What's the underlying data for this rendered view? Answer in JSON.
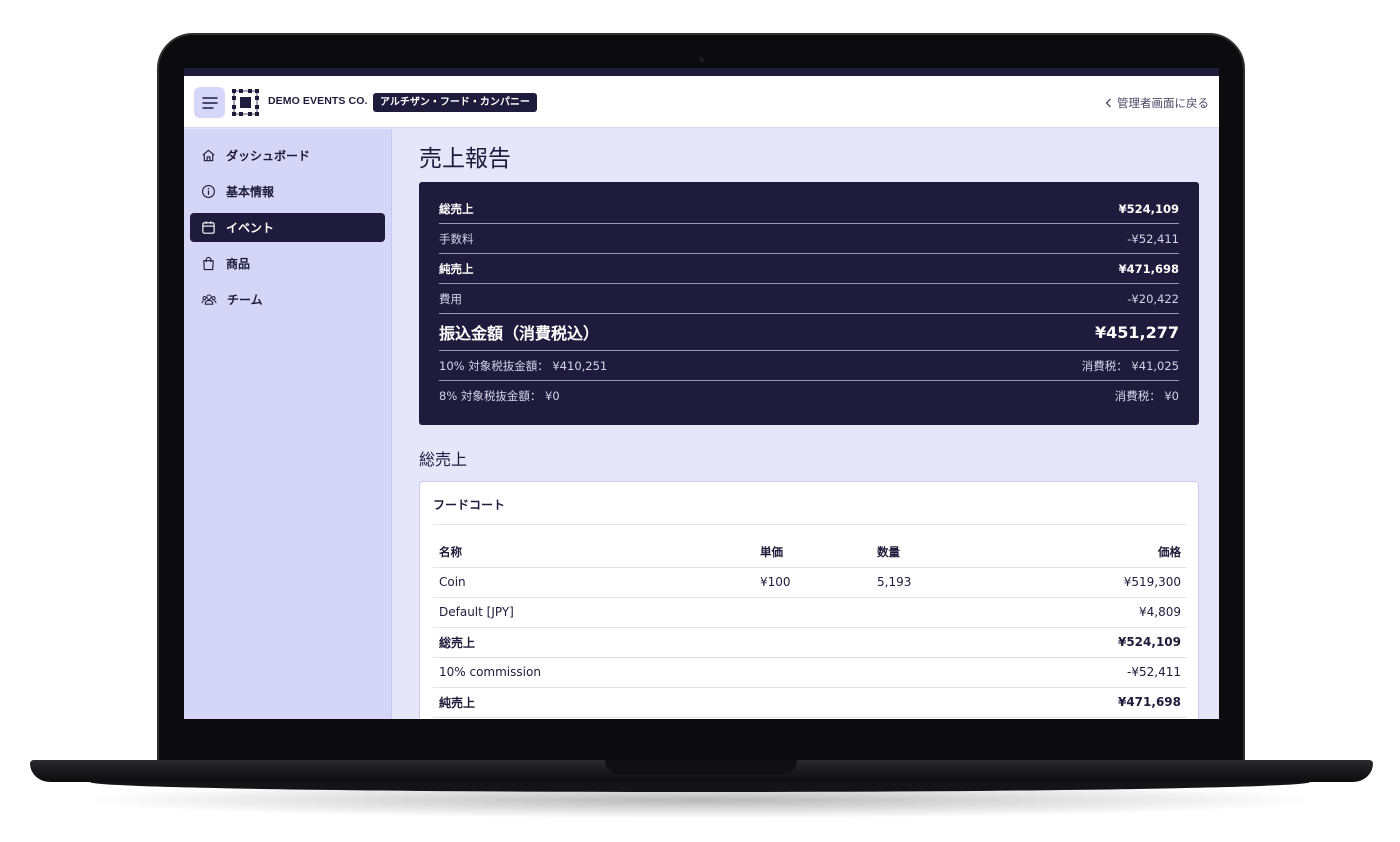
{
  "header": {
    "company_name": "DEMO EVENTS CO.",
    "org_badge": "アルチザン・フード・カンパニー",
    "back_link": "管理者画面に戻る"
  },
  "sidebar": {
    "items": [
      {
        "label": "ダッシュボード",
        "icon": "home-icon",
        "active": false
      },
      {
        "label": "基本情報",
        "icon": "info-icon",
        "active": false
      },
      {
        "label": "イベント",
        "icon": "calendar-icon",
        "active": true
      },
      {
        "label": "商品",
        "icon": "shopping-bag-icon",
        "active": false
      },
      {
        "label": "チーム",
        "icon": "users-icon",
        "active": false
      }
    ]
  },
  "main": {
    "title": "売上報告",
    "summary": {
      "gross_label": "総売上",
      "gross_value": "¥524,109",
      "fee_label": "手数料",
      "fee_value": "-¥52,411",
      "net_label": "純売上",
      "net_value": "¥471,698",
      "expense_label": "費用",
      "expense_value": "-¥20,422",
      "payout_label": "振込金額（消費税込）",
      "payout_value": "¥451,277",
      "tax10_label": "10% 対象税抜金額： ¥410,251",
      "tax10_value": "消費税： ¥41,025",
      "tax8_label": "8% 対象税抜金額： ¥0",
      "tax8_value": "消費税： ¥0"
    },
    "section_title": "総売上",
    "food_court": {
      "title": "フードコート",
      "columns": [
        "名称",
        "単価",
        "数量",
        "価格"
      ],
      "rows": [
        {
          "name": "Coin",
          "unit_price": "¥100",
          "qty": "5,193",
          "price": "¥519,300",
          "bold": false
        },
        {
          "name": "Default [JPY]",
          "unit_price": "",
          "qty": "",
          "price": "¥4,809",
          "bold": false
        },
        {
          "name": "総売上",
          "unit_price": "",
          "qty": "",
          "price": "¥524,109",
          "bold": true
        },
        {
          "name": "10% commission",
          "unit_price": "",
          "qty": "",
          "price": "-¥52,411",
          "bold": false
        },
        {
          "name": "純売上",
          "unit_price": "",
          "qty": "",
          "price": "¥471,698",
          "bold": true
        }
      ]
    }
  },
  "colors": {
    "brand_dark": "#1f1b3c",
    "sidebar_bg": "#d5d5f8",
    "main_bg": "#e6e6fb",
    "menu_button_bg": "#d6d6fa"
  }
}
